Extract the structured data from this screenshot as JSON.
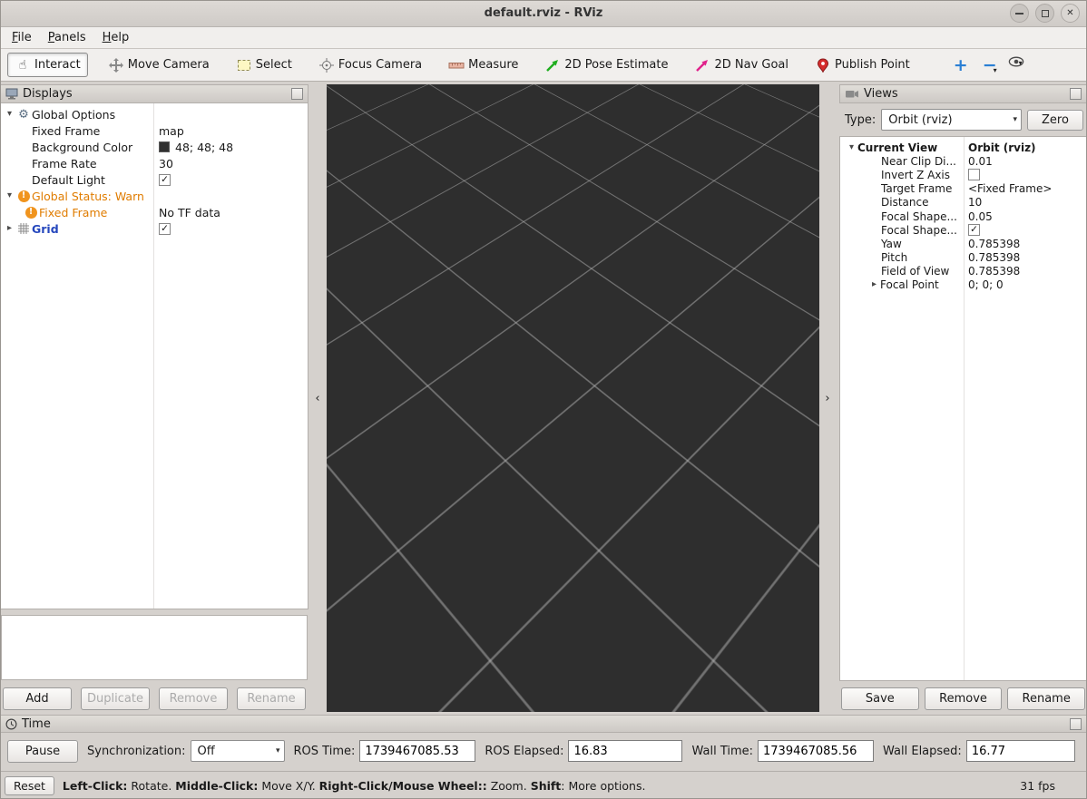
{
  "window": {
    "title": "default.rviz - RViz"
  },
  "menubar": {
    "items": [
      "File",
      "Panels",
      "Help"
    ]
  },
  "toolbar": {
    "interact": "Interact",
    "move_camera": "Move Camera",
    "select": "Select",
    "focus_camera": "Focus Camera",
    "measure": "Measure",
    "pose_estimate": "2D Pose Estimate",
    "nav_goal": "2D Nav Goal",
    "publish_point": "Publish Point"
  },
  "displays_panel": {
    "title": "Displays",
    "rows": [
      {
        "label": "Global Options",
        "value": ""
      },
      {
        "label": "Fixed Frame",
        "value": "map"
      },
      {
        "label": "Background Color",
        "value": "48; 48; 48"
      },
      {
        "label": "Frame Rate",
        "value": "30"
      },
      {
        "label": "Default Light",
        "value": "checked"
      },
      {
        "label": "Global Status: Warn",
        "value": ""
      },
      {
        "label": "Fixed Frame",
        "value": "No TF data"
      },
      {
        "label": "Grid",
        "value": "checked"
      }
    ],
    "buttons": {
      "add": "Add",
      "duplicate": "Duplicate",
      "remove": "Remove",
      "rename": "Rename"
    }
  },
  "views_panel": {
    "title": "Views",
    "type_label": "Type:",
    "type_value": "Orbit (rviz)",
    "zero": "Zero",
    "root": {
      "label": "Current View",
      "value": "Orbit (rviz)"
    },
    "rows": [
      {
        "label": "Near Clip Di...",
        "value": "0.01"
      },
      {
        "label": "Invert Z Axis",
        "value": "unchecked"
      },
      {
        "label": "Target Frame",
        "value": "<Fixed Frame>"
      },
      {
        "label": "Distance",
        "value": "10"
      },
      {
        "label": "Focal Shape...",
        "value": "0.05"
      },
      {
        "label": "Focal Shape...",
        "value": "checked"
      },
      {
        "label": "Yaw",
        "value": "0.785398"
      },
      {
        "label": "Pitch",
        "value": "0.785398"
      },
      {
        "label": "Field of View",
        "value": "0.785398"
      },
      {
        "label": "Focal Point",
        "value": "0; 0; 0"
      }
    ],
    "buttons": {
      "save": "Save",
      "remove": "Remove",
      "rename": "Rename"
    }
  },
  "time_panel": {
    "title": "Time",
    "pause": "Pause",
    "sync_label": "Synchronization:",
    "sync_value": "Off",
    "ros_time_label": "ROS Time:",
    "ros_time_value": "1739467085.53",
    "ros_elapsed_label": "ROS Elapsed:",
    "ros_elapsed_value": "16.83",
    "wall_time_label": "Wall Time:",
    "wall_time_value": "1739467085.56",
    "wall_elapsed_label": "Wall Elapsed:",
    "wall_elapsed_value": "16.77"
  },
  "statusbar": {
    "reset": "Reset",
    "help": [
      {
        "text": "Left-Click:"
      },
      {
        "text": " Rotate. "
      },
      {
        "text": "Middle-Click:"
      },
      {
        "text": " Move X/Y. "
      },
      {
        "text": "Right-Click/Mouse Wheel::"
      },
      {
        "text": " Zoom. "
      },
      {
        "text": "Shift"
      },
      {
        "text": ": More options."
      }
    ],
    "fps": "31 fps"
  },
  "colors": {
    "viewport_bg": "#2e2e2e",
    "background_color_swatch": "#303030",
    "warn_orange": "#e07c00",
    "enabled_blue": "#2547bd",
    "tool_plus_blue": "#2a7fd4",
    "pose_green": "#1fae1f",
    "goal_magenta": "#e0218a",
    "pin_red": "#d62d2d"
  },
  "icons": {
    "expander_open": "▾",
    "expander_closed": "▸",
    "gear": "⚙",
    "warning_mark": "!",
    "check_mark": "✓",
    "dropdown": "▾",
    "collapse_left": "‹",
    "collapse_right": "›",
    "plus": "+",
    "minus": "−",
    "close": "✕",
    "hand": "☝"
  }
}
